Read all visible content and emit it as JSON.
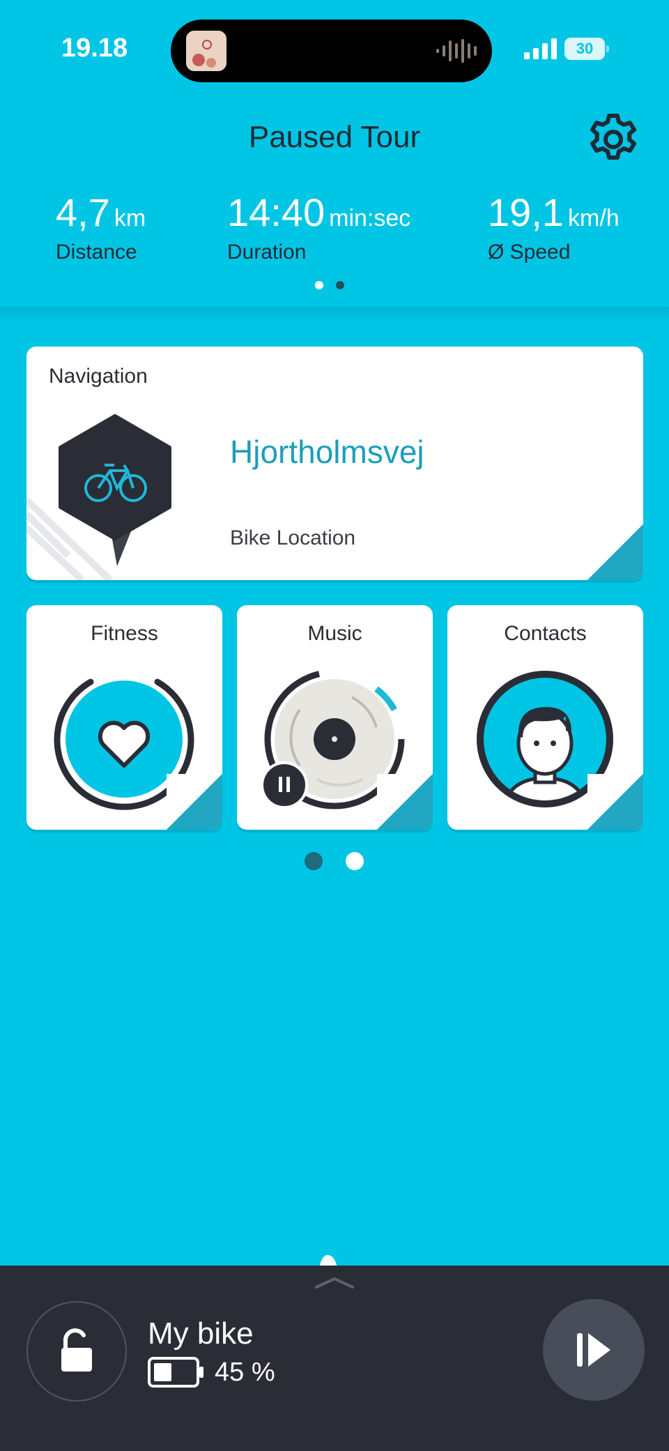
{
  "status_bar": {
    "time": "19.18",
    "battery": "30"
  },
  "header": {
    "title": "Paused Tour",
    "stats": [
      {
        "value": "4,7",
        "unit": "km",
        "label": "Distance"
      },
      {
        "value": "14:40",
        "unit": "min:sec",
        "label": "Duration"
      },
      {
        "value": "19,1",
        "unit": "km/h",
        "label": "Ø Speed"
      }
    ]
  },
  "navigation_card": {
    "label": "Navigation",
    "street": "Hjortholmsvej",
    "subtitle": "Bike Location"
  },
  "tiles": [
    {
      "label": "Fitness",
      "icon": "heart-icon"
    },
    {
      "label": "Music",
      "icon": "vinyl-icon"
    },
    {
      "label": "Contacts",
      "icon": "person-icon"
    }
  ],
  "bike_panel": {
    "name": "My bike",
    "battery": "45 %",
    "battery_level": 0.45
  },
  "colors": {
    "background": "#00C5E5",
    "accent": "#1B9EBA",
    "dark": "#2B2D33",
    "panel": "#2B2D36"
  }
}
